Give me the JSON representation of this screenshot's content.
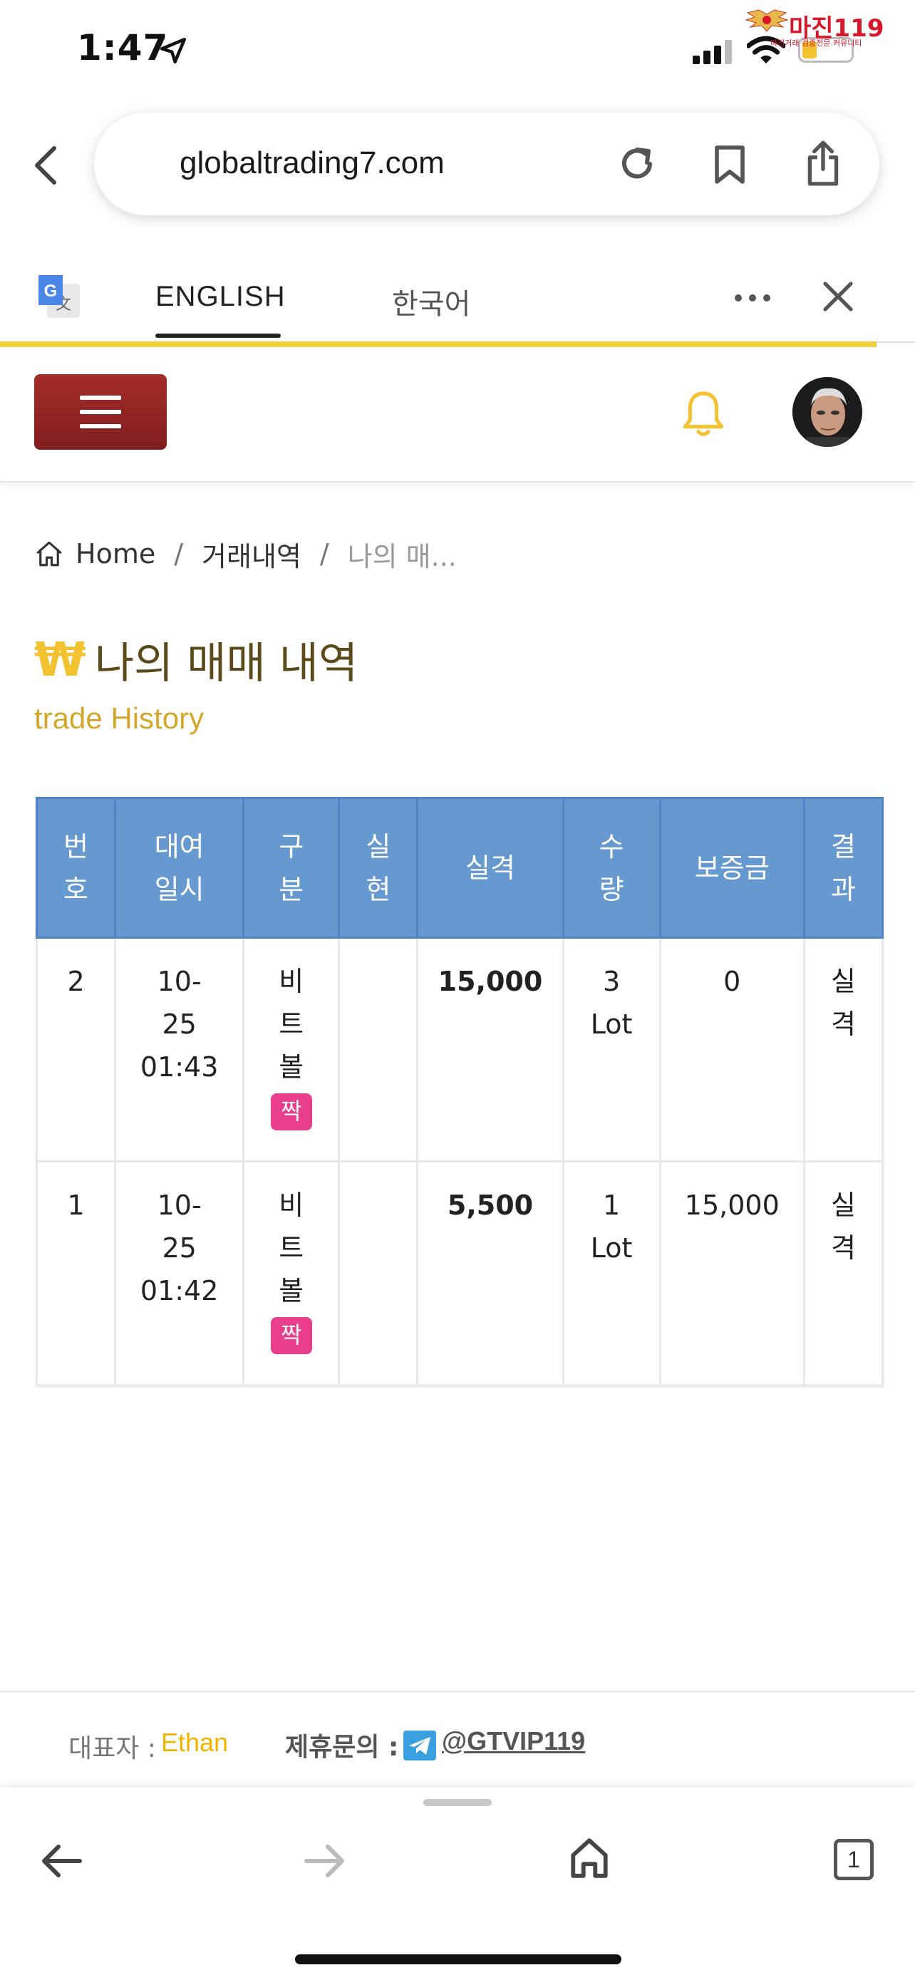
{
  "status_bar": {
    "time": "1:47"
  },
  "watermark": {
    "title": "마진119",
    "subtitle": "마진거래 검증전문 커뮤니티"
  },
  "browser": {
    "url": "globaltrading7.com"
  },
  "translate_bar": {
    "tab_english": "ENGLISH",
    "tab_korean": "한국어"
  },
  "breadcrumb": {
    "home": "Home",
    "sep": "/",
    "level2": "거래내역",
    "current": "나의 매..."
  },
  "page": {
    "title_icon": "₩",
    "title": "나의 매매 내역",
    "subtitle": "trade History"
  },
  "table": {
    "headers": [
      "번\n호",
      "대여\n일시",
      "구\n분",
      "실\n현",
      "실격",
      "수\n량",
      "보증금",
      "결\n과"
    ],
    "rows": [
      {
        "no": "2",
        "datetime": "10-\n25\n01:43",
        "type": "비\n트\n볼",
        "badge": "짝",
        "realized": "",
        "price": "15,000",
        "qty": "3\nLot",
        "deposit": "0",
        "result": "실\n격"
      },
      {
        "no": "1",
        "datetime": "10-\n25\n01:42",
        "type": "비\n트\n볼",
        "badge": "짝",
        "realized": "",
        "price": "5,500",
        "qty": "1\nLot",
        "deposit": "15,000",
        "result": "실\n격"
      }
    ]
  },
  "footer": {
    "rep_label": "대표자 :",
    "rep_name": "Ethan",
    "contact_label": "제휴문의 :",
    "contact": "@GTVIP119"
  },
  "bottom_bar": {
    "tab_count": "1"
  },
  "colors": {
    "accent_yellow": "#f3cf3e",
    "menu_red": "#8b2420",
    "table_header_blue": "#6599d0",
    "price_red": "#b02a2a",
    "badge_pink": "#e83e8c"
  }
}
